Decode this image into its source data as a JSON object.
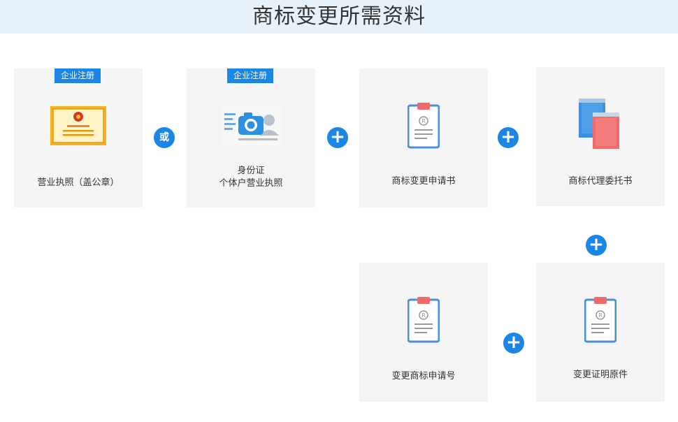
{
  "title": "商标变更所需资料",
  "cards": {
    "license": {
      "tag": "企业注册",
      "label": "营业执照（盖公章）"
    },
    "idcard": {
      "tag": "企业注册",
      "label_line1": "身份证",
      "label_line2": "个体户营业执照"
    },
    "application": {
      "label": "商标变更申请书"
    },
    "power_of_attorney": {
      "label": "商标代理委托书"
    },
    "registration_no": {
      "label": "变更商标申请号"
    },
    "certificate": {
      "label": "变更证明原件"
    }
  },
  "connectors": {
    "or": "或",
    "plus": "+"
  },
  "icons": {
    "license": "business-license-icon",
    "idcard": "id-card-camera-icon",
    "application": "clipboard-document-icon",
    "power_of_attorney": "books-icon",
    "registration_no": "clipboard-document-icon",
    "certificate": "clipboard-document-icon"
  },
  "colors": {
    "accent": "#1b86e4",
    "header_bg": "#e6f1fa",
    "card_bg": "#f4f4f4",
    "book_red": "#f06a6a"
  }
}
